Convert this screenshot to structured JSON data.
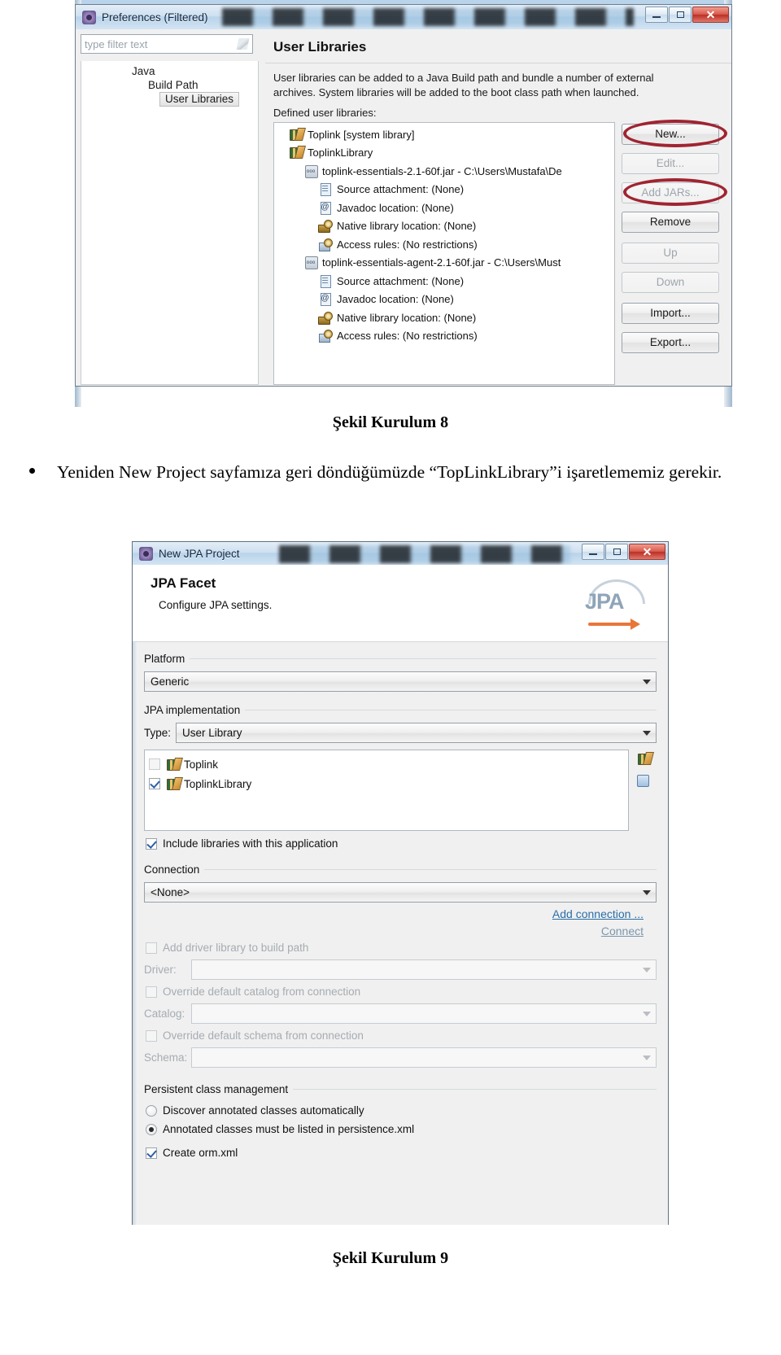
{
  "preferences_dialog": {
    "title": "Preferences (Filtered)",
    "window_buttons": {
      "minimize": "–",
      "maximize": "□",
      "close": "✕"
    },
    "filter_placeholder": "type filter text",
    "tree": [
      {
        "label": "Java",
        "level": 1,
        "selected": false
      },
      {
        "label": "Build Path",
        "level": 2,
        "selected": false
      },
      {
        "label": "User Libraries",
        "level": 3,
        "selected": true
      }
    ],
    "page_title": "User Libraries",
    "description_line1": "User libraries can be added to a Java Build path and bundle a number of external",
    "description_line2": "archives. System libraries will be added to the boot class path when launched.",
    "defined_label": "Defined user libraries:",
    "library_tree": [
      {
        "label": "Toplink [system library]",
        "icon": "books-icon",
        "depth": 1
      },
      {
        "label": "ToplinkLibrary",
        "icon": "books-icon",
        "depth": 1
      },
      {
        "label": "toplink-essentials-2.1-60f.jar - C:\\Users\\Mustafa\\De",
        "icon": "jar-icon",
        "depth": 2
      },
      {
        "label": "Source attachment: (None)",
        "icon": "source-icon",
        "depth": 3
      },
      {
        "label": "Javadoc location: (None)",
        "icon": "javadoc-icon",
        "depth": 3
      },
      {
        "label": "Native library location: (None)",
        "icon": "native-library-icon",
        "depth": 3
      },
      {
        "label": "Access rules: (No restrictions)",
        "icon": "access-rules-icon",
        "depth": 3
      },
      {
        "label": "toplink-essentials-agent-2.1-60f.jar - C:\\Users\\Must",
        "icon": "jar-icon",
        "depth": 2
      },
      {
        "label": "Source attachment: (None)",
        "icon": "source-icon",
        "depth": 3
      },
      {
        "label": "Javadoc location: (None)",
        "icon": "javadoc-icon",
        "depth": 3
      },
      {
        "label": "Native library location: (None)",
        "icon": "native-library-icon",
        "depth": 3
      },
      {
        "label": "Access rules: (No restrictions)",
        "icon": "access-rules-icon",
        "depth": 3
      }
    ],
    "buttons": [
      {
        "label": "New...",
        "enabled": true,
        "highlighted": true
      },
      {
        "label": "Edit...",
        "enabled": false,
        "highlighted": false
      },
      {
        "label": "Add JARs...",
        "enabled": false,
        "highlighted": true
      },
      {
        "label": "Remove",
        "enabled": true,
        "highlighted": false
      },
      {
        "label": "Up",
        "enabled": false,
        "highlighted": false
      },
      {
        "label": "Down",
        "enabled": false,
        "highlighted": false
      },
      {
        "label": "Import...",
        "enabled": true,
        "highlighted": false
      },
      {
        "label": "Export...",
        "enabled": true,
        "highlighted": false
      }
    ],
    "highlight_color": "#a02431"
  },
  "caption_8": "Şekil Kurulum 8",
  "bullet_text": "Yeniden New Project sayfamıza geri döndüğümüzde “TopLinkLibrary”i işaretlememiz gerekir.",
  "jpa_dialog": {
    "title": "New JPA Project",
    "page_title": "JPA Facet",
    "page_subtitle": "Configure JPA settings.",
    "logo_text": "JPA",
    "platform": {
      "legend": "Platform",
      "value": "Generic"
    },
    "jpa_implementation": {
      "legend": "JPA implementation",
      "type_label": "Type:",
      "type_value": "User Library",
      "libraries": [
        {
          "label": "Toplink",
          "checked": false
        },
        {
          "label": "ToplinkLibrary",
          "checked": true
        }
      ],
      "include_libraries_label": "Include libraries with this application",
      "include_libraries_checked": true
    },
    "connection": {
      "legend": "Connection",
      "value": "<None>",
      "add_connection_link": "Add connection ...",
      "connect_link": "Connect",
      "add_driver_label": "Add driver library to build path",
      "add_driver_checked": false,
      "driver_label": "Driver:",
      "driver_value": "",
      "override_catalog_label": "Override default catalog from connection",
      "override_catalog_checked": false,
      "catalog_label": "Catalog:",
      "catalog_value": "",
      "override_schema_label": "Override default schema from connection",
      "override_schema_checked": false,
      "schema_label": "Schema:",
      "schema_value": ""
    },
    "persistent_class_management": {
      "legend": "Persistent class management",
      "options": [
        {
          "label": "Discover annotated classes automatically",
          "selected": false
        },
        {
          "label": "Annotated classes must be listed in persistence.xml",
          "selected": true
        }
      ]
    },
    "create_orm_label": "Create orm.xml",
    "create_orm_checked": true
  },
  "caption_9": "Şekil Kurulum 9"
}
